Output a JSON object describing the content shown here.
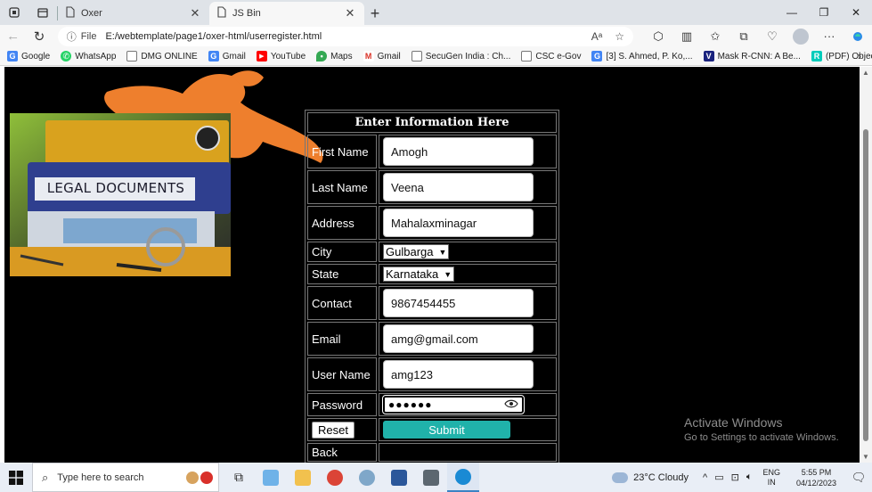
{
  "browser": {
    "tabs": [
      {
        "title": "Oxer",
        "active": false
      },
      {
        "title": "JS Bin",
        "active": true
      }
    ],
    "address": {
      "scheme_label": "File",
      "url": "E:/webtemplate/page1/oxer-html/userregister.html"
    },
    "bookmarks": [
      {
        "label": "Google",
        "icon": "G",
        "color": "#4285f4"
      },
      {
        "label": "WhatsApp",
        "icon": "W",
        "color": "#25d366"
      },
      {
        "label": "DMG ONLINE",
        "icon": "□",
        "color": "#888888"
      },
      {
        "label": "Gmail",
        "icon": "G",
        "color": "#ea4335"
      },
      {
        "label": "YouTube",
        "icon": "▶",
        "color": "#ff0000"
      },
      {
        "label": "Maps",
        "icon": "M",
        "color": "#34a853"
      },
      {
        "label": "Gmail",
        "icon": "M",
        "color": "#d93025"
      },
      {
        "label": "SecuGen India : Ch...",
        "icon": "□",
        "color": "#888888"
      },
      {
        "label": "CSC e-Gov",
        "icon": "□",
        "color": "#888888"
      },
      {
        "label": "[3] S. Ahmed, P. Ko,...",
        "icon": "G",
        "color": "#4285f4"
      },
      {
        "label": "Mask R-CNN: A Be...",
        "icon": "V",
        "color": "#1a237e"
      },
      {
        "label": "(PDF) Object Detect...",
        "icon": "R",
        "color": "#00ccbb"
      }
    ]
  },
  "page": {
    "image_text": "LEGAL DOCUMENTS",
    "form": {
      "heading": "Enter Information Here",
      "fields": {
        "first_name": {
          "label": "First Name",
          "value": "Amogh"
        },
        "last_name": {
          "label": "Last Name",
          "value": "Veena"
        },
        "address": {
          "label": "Address",
          "value": "Mahalaxminagar"
        },
        "city": {
          "label": "City",
          "value": "Gulbarga"
        },
        "state": {
          "label": "State",
          "value": "Karnataka"
        },
        "contact": {
          "label": "Contact",
          "value": "9867454455"
        },
        "email": {
          "label": "Email",
          "value": "amg@gmail.com"
        },
        "username": {
          "label": "User Name",
          "value": "amg123"
        },
        "password": {
          "label": "Password",
          "value": "●●●●●●"
        }
      },
      "reset_label": "Reset",
      "submit_label": "Submit",
      "back_label": "Back"
    },
    "watermark": {
      "line1": "Activate Windows",
      "line2": "Go to Settings to activate Windows."
    }
  },
  "taskbar": {
    "search_placeholder": "Type here to search",
    "weather": "23°C  Cloudy",
    "lang_line1": "ENG",
    "lang_line2": "IN",
    "time": "5:55 PM",
    "date": "04/12/2023"
  },
  "colors": {
    "submit": "#20b2aa",
    "page_bg": "#000000",
    "runner": "#ee7f2d"
  }
}
